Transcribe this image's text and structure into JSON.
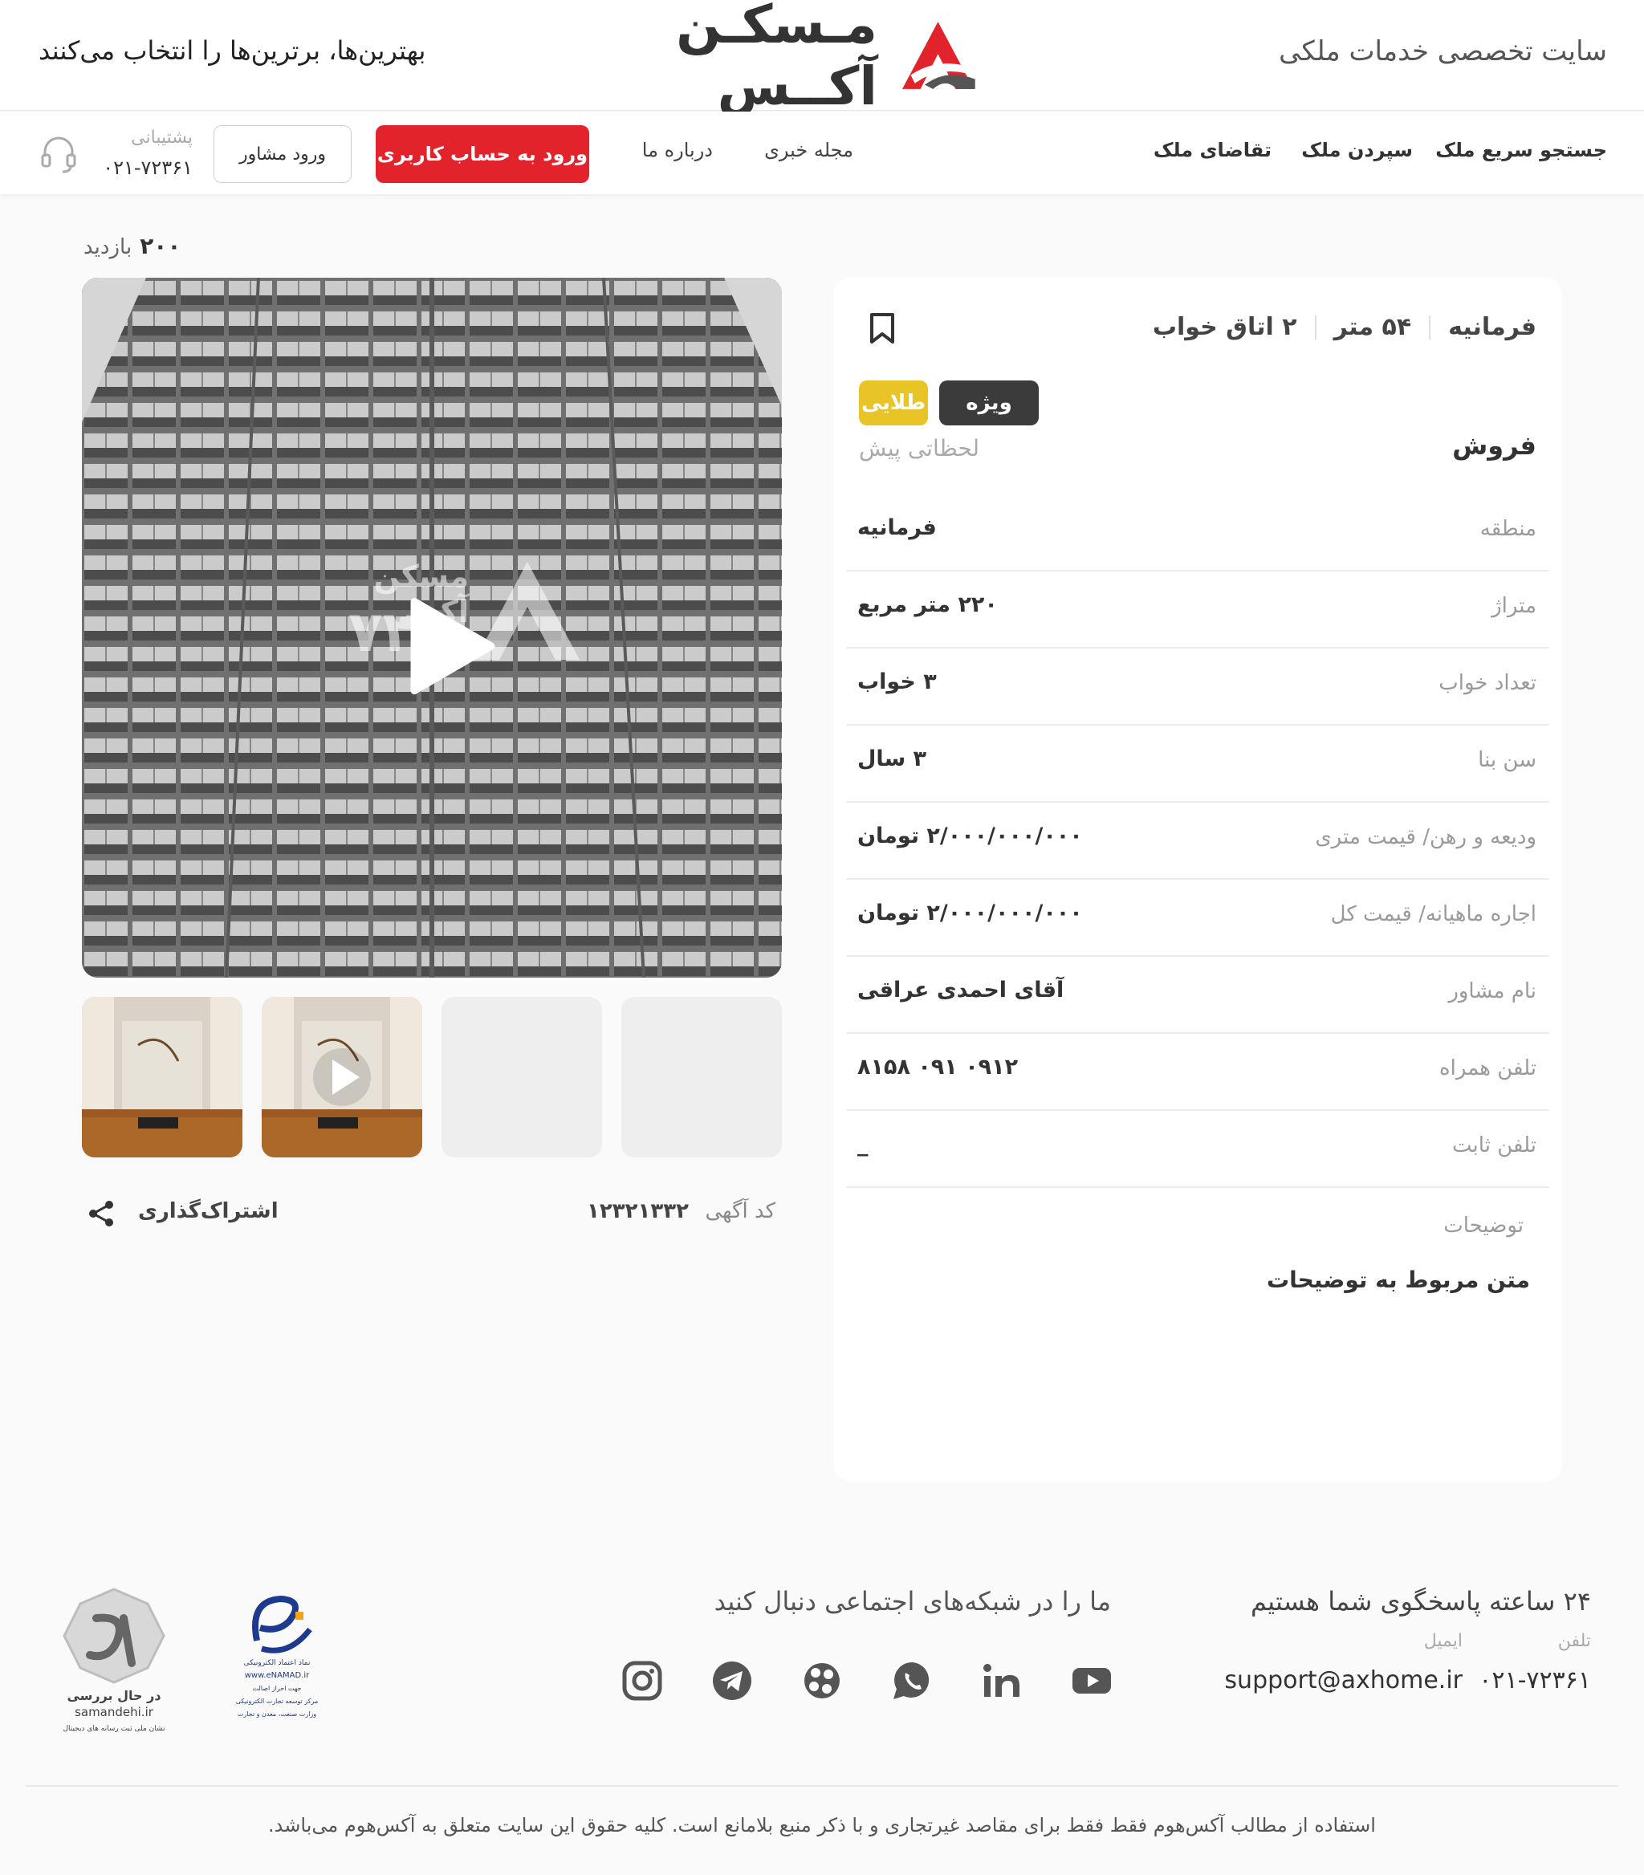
{
  "header": {
    "tagline_right": "سایت تخصصی خدمات ملکی",
    "brand_name": "مـسکـن آکــس",
    "tagline_left": "بهترین‌ها، برترین‌ها را انتخاب می‌کنند"
  },
  "nav": {
    "items": [
      "جستجو سریع ملک",
      "سپردن ملک",
      "تقاضای ملک",
      "مجله خبری",
      "درباره ما"
    ],
    "login_button": "ورود به حساب کاربری",
    "advisor_button": "ورود مشاور",
    "support_label": "پشتیبانی",
    "support_phone": "۰۲۱-۷۲۳۶۱"
  },
  "listing": {
    "views_count": "۲۰۰",
    "views_label": "بازدید",
    "watermark_name": "مسکن آکس",
    "watermark_number": "۷۲۳",
    "code_label": "کد آگهی",
    "code_value": "۱۲۳۲۱۳۳۲",
    "share_label": "اشتراک‌گذاری"
  },
  "card": {
    "region": "فرمانیه",
    "area": "۵۴ متر",
    "bedrooms": "۲ اتاق خواب",
    "badge_special": "ویژه",
    "badge_gold": "طلایی",
    "deal_type": "فروش",
    "posted": "لحظاتی پیش",
    "details": [
      {
        "key": "منطقه",
        "value": "فرمانیه"
      },
      {
        "key": "متراژ",
        "value": "۲۲۰ متر مربع"
      },
      {
        "key": "تعداد خواب",
        "value": "۳ خواب"
      },
      {
        "key": "سن بنا",
        "value": "۳ سال"
      },
      {
        "key": "ودیعه و رهن/ قیمت متری",
        "value": "۲/۰۰۰/۰۰۰/۰۰۰ تومان"
      },
      {
        "key": "اجاره ماهیانه/ قیمت کل",
        "value": "۲/۰۰۰/۰۰۰/۰۰۰ تومان"
      },
      {
        "key": "نام مشاور",
        "value": "آقای احمدی عراقی"
      },
      {
        "key": "تلفن همراه",
        "value": "۰۹۱۲ ۰۹۱ ۸۱۵۸"
      },
      {
        "key": "تلفن ثابت",
        "value": "_"
      }
    ],
    "description_label": "توضیحات",
    "description_text": "متن مربوط به توضیحات"
  },
  "footer": {
    "available": "۲۴ ساعته پاسخگوی شما هستیم",
    "phone_label": "تلفن",
    "email_label": "ایمیل",
    "phone": "۰۲۱-۷۲۳۶۱",
    "email": "support@axhome.ir",
    "follow": "ما را در شبکه‌های اجتماعی دنبال کنید",
    "social_icons": [
      "youtube-icon",
      "linkedin-icon",
      "whatsapp-icon",
      "aparat-icon",
      "telegram-icon",
      "instagram-icon"
    ],
    "enamad_text": "www.eNAMAD.ir",
    "samandehi_status": "در حال بررسی",
    "samandehi_site": "samandehi.ir",
    "copyright": "استفاده از مطالب آکس‌هوم فقط فقط برای مقاصد غیرتجاری و با ذکر منبع بلامانع است. کلیه حقوق این سایت متعلق  به آکس‌هوم می‌باشد."
  },
  "colors": {
    "accent": "#e3232b",
    "gold": "#e9c427",
    "dark_badge": "#3b3b3b"
  }
}
